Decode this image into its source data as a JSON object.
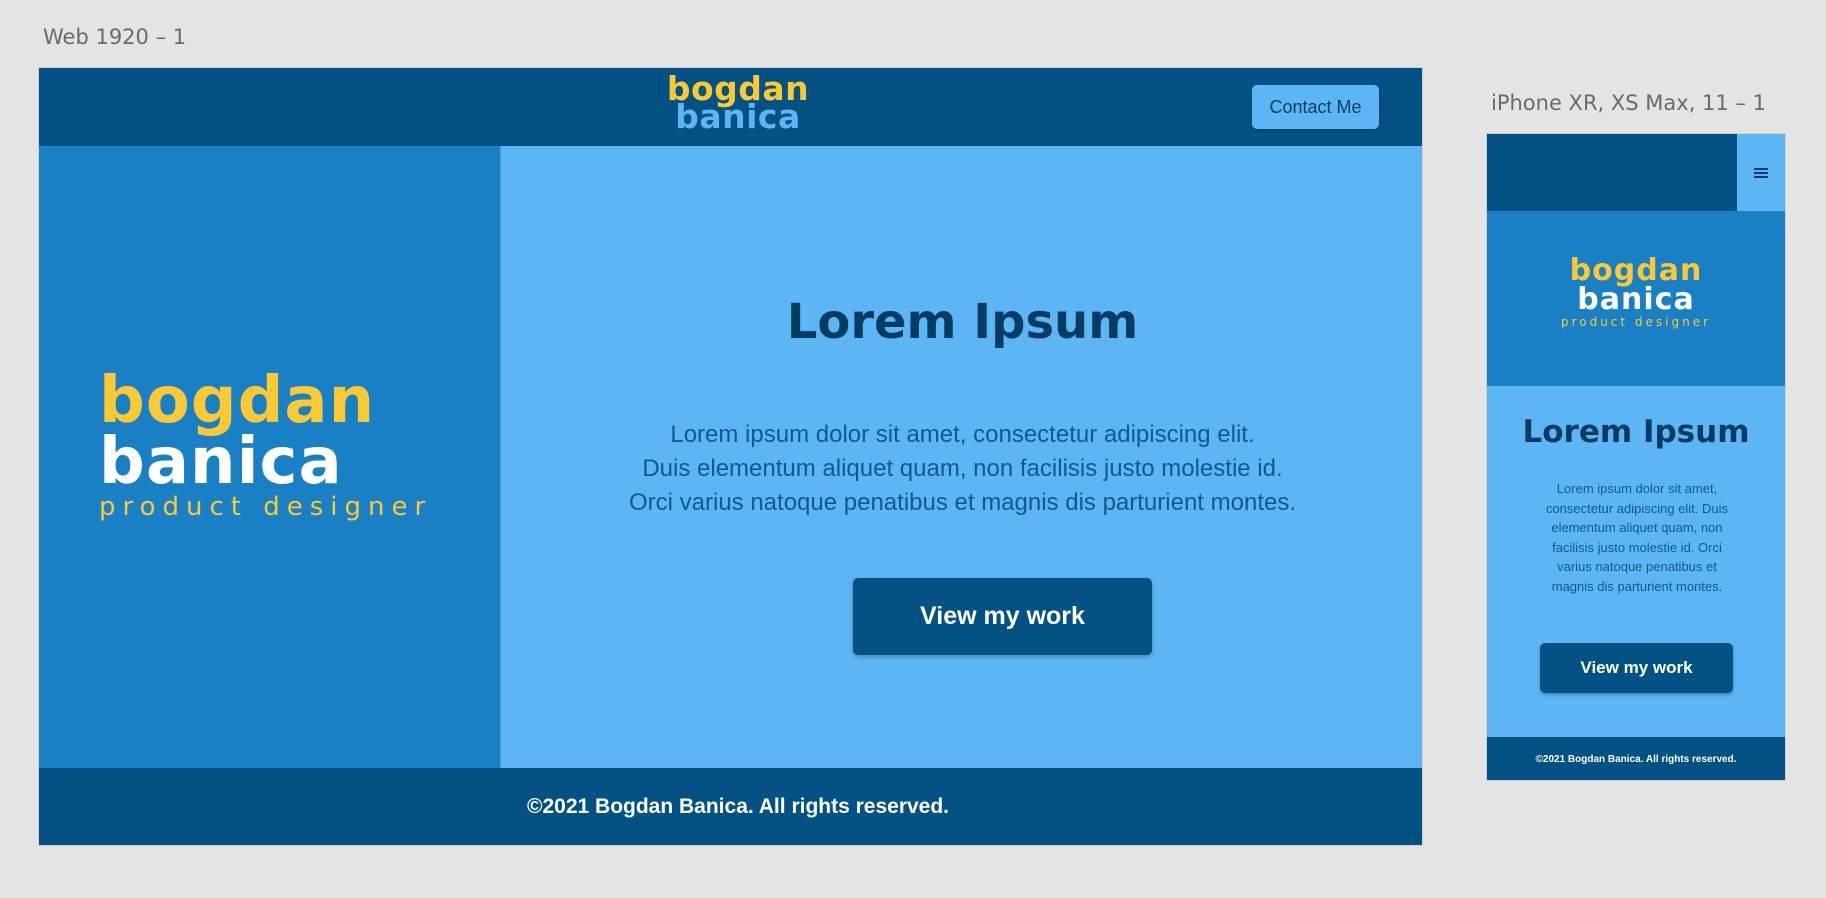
{
  "canvas": {
    "web_label": "Web 1920 – 1",
    "mobile_label": "iPhone XR, XS Max, 11 – 1"
  },
  "web": {
    "header": {
      "logo_line1": "bogdan",
      "logo_line2": "banica",
      "contact_label": "Contact Me"
    },
    "hero_logo": {
      "line1": "bogdan",
      "line2": "banica",
      "tagline": "product designer"
    },
    "main": {
      "title": "Lorem Ipsum",
      "paragraph_lines": [
        "Lorem ipsum dolor sit amet, consectetur adipiscing elit.",
        "Duis elementum aliquet quam, non facilisis justo molestie id.",
        "Orci varius natoque penatibus et magnis dis parturient montes."
      ],
      "cta_label": "View my work"
    },
    "footer": {
      "text": "©2021 Bogdan Banica. All rights reserved."
    }
  },
  "mobile": {
    "menu_icon": "hamburger-icon",
    "hero_logo": {
      "line1": "bogdan",
      "line2": "banica",
      "tagline": "product designer"
    },
    "title": "Lorem Ipsum",
    "paragraph": "Lorem ipsum dolor sit amet, consectetur adipiscing elit. Duis elementum aliquet quam, non facilisis justo molestie id. Orci varius natoque penatibus et magnis dis parturient montes.",
    "cta_label": "View my work",
    "footer_text": "©2021 Bogdan Banica. All rights reserved."
  },
  "colors": {
    "dark_navy": "#045283",
    "mid_blue": "#1980c5",
    "light_blue": "#5bb6f3",
    "yellow": "#fbc935",
    "title_text": "#063c63"
  }
}
